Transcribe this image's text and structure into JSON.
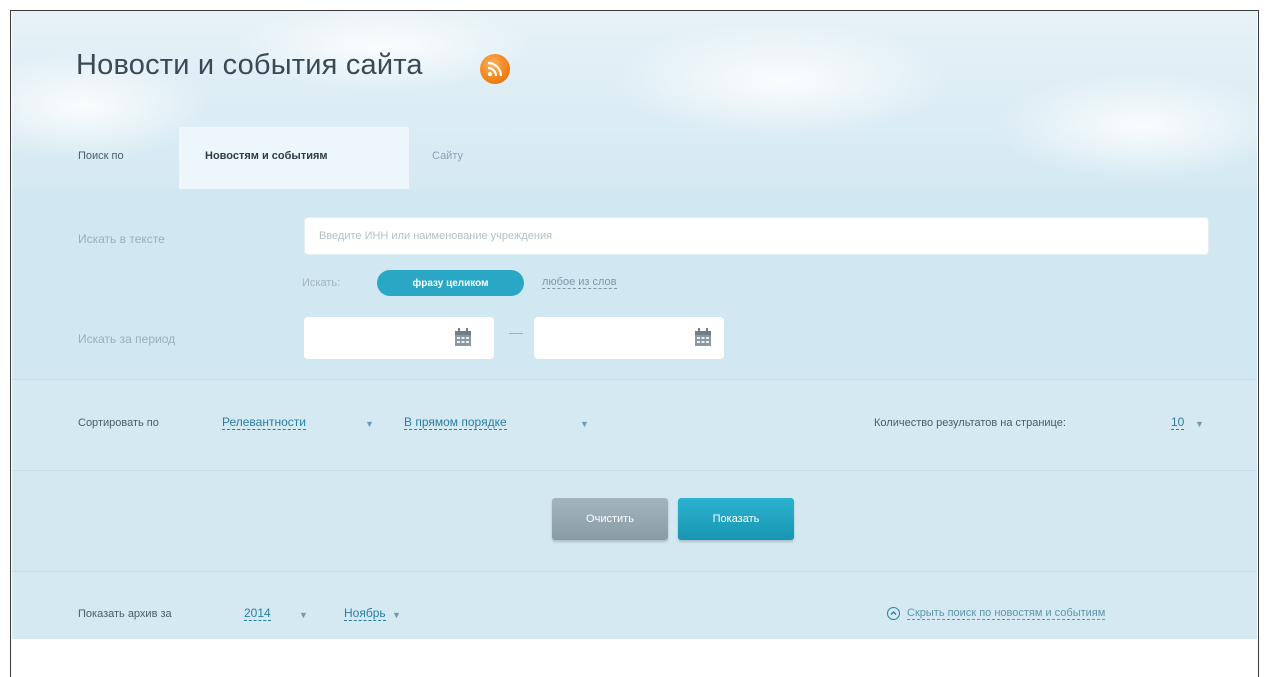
{
  "page": {
    "title": "Новости и события сайта",
    "rss_icon": "rss-icon"
  },
  "tabs": {
    "search_by_label": "Поиск по",
    "active_tab": "Новостям и событиям",
    "other_tab": "Сайту"
  },
  "search": {
    "text_label": "Искать в тексте",
    "text_placeholder": "Введите ИНН или наименование учреждения",
    "mode_label": "Искать:",
    "mode_exact": "фразу целиком",
    "mode_any": "любое из слов",
    "period_label": "Искать за период"
  },
  "sorting": {
    "label": "Сортировать по",
    "field": "Релевантности",
    "order": "В прямом порядке",
    "results_per_page_label": "Количество результатов на странице:",
    "results_per_page_value": "10"
  },
  "buttons": {
    "clear": "Очистить",
    "show": "Показать"
  },
  "archive": {
    "label": "Показать архив за",
    "year": "2014",
    "month": "Ноябрь",
    "hide_link": "Скрыть поиск по новостям и событиям"
  },
  "colors": {
    "accent": "#2aa7c4",
    "rss": "#f0821a",
    "link": "#2c7ea0",
    "panel_bg": "#d3e8f1"
  }
}
